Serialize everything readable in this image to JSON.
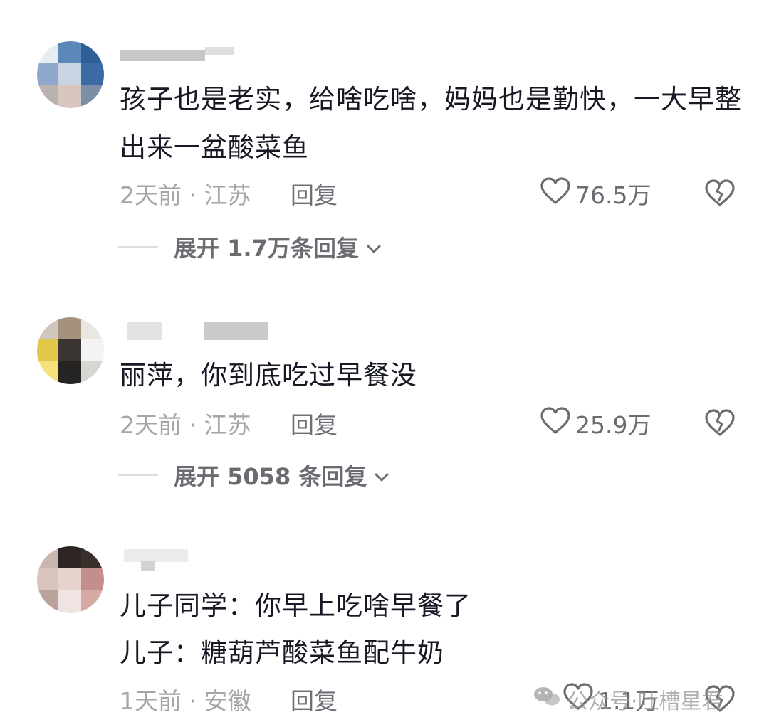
{
  "comments": [
    {
      "text": "孩子也是老实，给啥吃啥，妈妈也是勤快，一大早整出来一盆酸菜鱼",
      "time_location": "2天前 · 江苏",
      "reply_label": "回复",
      "likes": "76.5万",
      "expand_label": "展开 1.7万条回复"
    },
    {
      "text": "丽萍，你到底吃过早餐没",
      "time_location": "2天前 · 江苏",
      "reply_label": "回复",
      "likes": "25.9万",
      "expand_label": "展开 5058 条回复"
    },
    {
      "text_lines": [
        "儿子同学：你早上吃啥早餐了",
        "儿子：糖葫芦酸菜鱼配牛奶"
      ],
      "time_location": "1天前 · 安徽",
      "reply_label": "回复",
      "likes": "1.1万"
    }
  ],
  "watermark": {
    "label": "公众号·吐槽星君",
    "icon": "wechat-icon"
  },
  "icons": {
    "like": "heart-outline-icon",
    "dislike": "broken-heart-icon",
    "expand": "chevron-down-icon"
  },
  "colors": {
    "text": "#161823",
    "meta": "#9b9ca1",
    "action": "#6b6c72"
  }
}
